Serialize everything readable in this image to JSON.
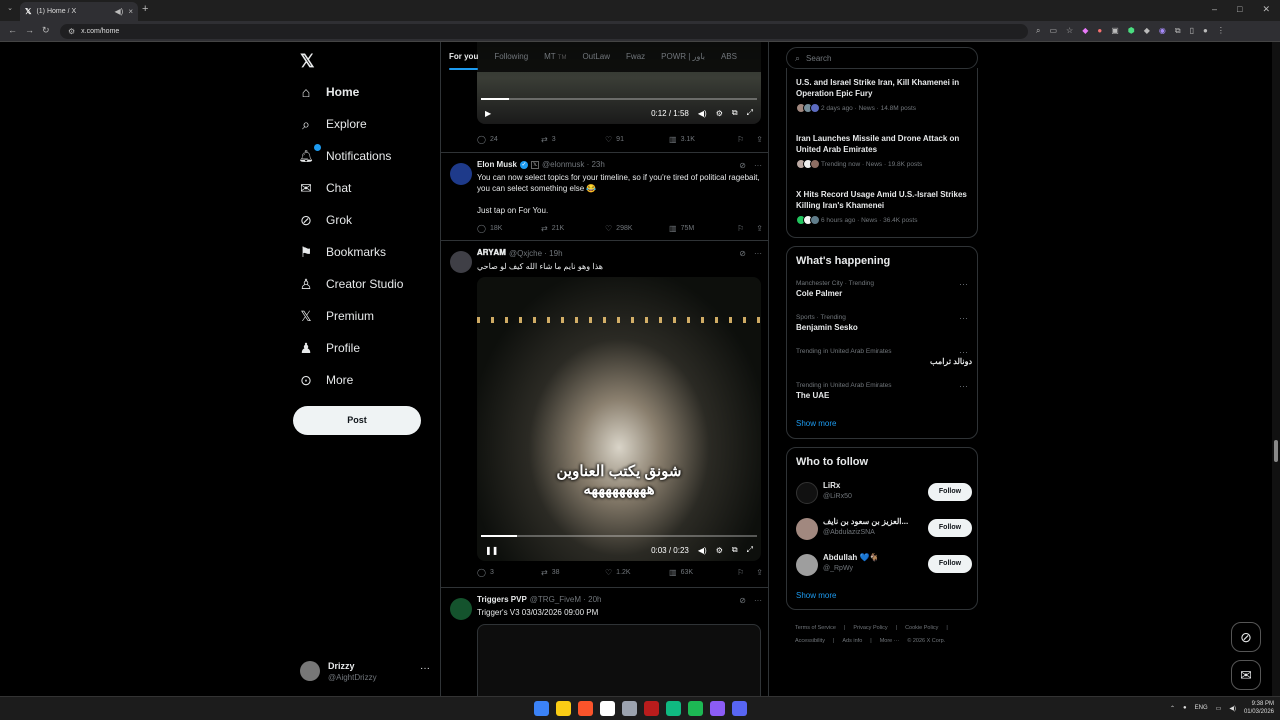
{
  "browser": {
    "tab_title": "(1) Home / X",
    "url": "x.com/home",
    "sound_icon": "speaker-icon",
    "close_glyph": "×",
    "new_tab_glyph": "+",
    "back_glyph": "←",
    "forward_glyph": "→",
    "reload_glyph": "↻",
    "minimize_glyph": "–",
    "maximize_glyph": "□",
    "window_close_glyph": "✕"
  },
  "nav": {
    "logo": "𝕏",
    "items": [
      {
        "label": "Home",
        "icon": "home-icon",
        "glyph": "⌂"
      },
      {
        "label": "Explore",
        "icon": "search-icon",
        "glyph": "⌕"
      },
      {
        "label": "Notifications",
        "icon": "bell-icon",
        "glyph": "🔔︎"
      },
      {
        "label": "Chat",
        "icon": "mail-icon",
        "glyph": "✉"
      },
      {
        "label": "Grok",
        "icon": "grok-icon",
        "glyph": "⊘"
      },
      {
        "label": "Bookmarks",
        "icon": "bookmark-icon",
        "glyph": "⚑"
      },
      {
        "label": "Creator Studio",
        "icon": "creator-icon",
        "glyph": "♙"
      },
      {
        "label": "Premium",
        "icon": "x-premium-icon",
        "glyph": "𝕏"
      },
      {
        "label": "Profile",
        "icon": "person-icon",
        "glyph": "♟"
      },
      {
        "label": "More",
        "icon": "more-circle-icon",
        "glyph": "⊙"
      }
    ],
    "post_label": "Post",
    "account": {
      "name": "Drizzy",
      "handle": "@AightDrizzy",
      "more": "···"
    }
  },
  "feed_tabs": [
    {
      "label": "For you",
      "suffix": ""
    },
    {
      "label": "Following",
      "suffix": ""
    },
    {
      "label": "MT",
      "suffix": "TM"
    },
    {
      "label": "OutLaw",
      "suffix": ""
    },
    {
      "label": "Fwaz",
      "suffix": ""
    },
    {
      "label": "POWR | باور",
      "suffix": ""
    },
    {
      "label": "ABS",
      "suffix": ""
    }
  ],
  "video1": {
    "time": "0:12 / 1:58",
    "progress": 0.1
  },
  "post0_actions": {
    "replies": "24",
    "reposts": "3",
    "likes": "91",
    "views": "3.1K"
  },
  "post1": {
    "name": "Elon Musk",
    "affiliation": "𝕏",
    "handle": "@elonmusk · 23h",
    "text": "You can now select topics for your timeline, so if you're tired of political ragebait, you can select something else 😂\n\nJust tap on For You.",
    "replies": "18K",
    "reposts": "21K",
    "likes": "298K",
    "views": "75M"
  },
  "post2": {
    "name": "𝐀𝐑𝐘𝐀𝐌",
    "handle": "@Qxjche · 19h",
    "text": "هذا وهو نايم ما شاء الله كيف لو صاحي",
    "video_caption": "شونق يكتب العناوين\nهههههههههه",
    "video_time": "0:03 / 0:23",
    "video_progress": 0.13,
    "replies": "3",
    "reposts": "38",
    "likes": "1.2K",
    "views": "63K"
  },
  "post3": {
    "name": "Triggers PVP",
    "handle": "@TRG_FiveM · 20h",
    "text": "Trigger's V3  03/03/2026 09:00 PM"
  },
  "search": {
    "placeholder": "Search"
  },
  "news": [
    {
      "title": "U.S. and Israel Strike Iran, Kill Khamenei in Operation Epic Fury",
      "meta": "2 days ago · News · 14.8M posts"
    },
    {
      "title": "Iran Launches Missile and Drone Attack on United Arab Emirates",
      "meta": "Trending now · News · 19.8K posts"
    },
    {
      "title": "X Hits Record Usage Amid U.S.-Israel Strikes Killing Iran's Khamenei",
      "meta": "6 hours ago · News · 36.4K posts"
    }
  ],
  "happening": {
    "title": "What's happening",
    "trends": [
      {
        "category": "Manchester City · Trending",
        "name": "Cole Palmer"
      },
      {
        "category": "Sports · Trending",
        "name": "Benjamin Sesko"
      },
      {
        "category": "Trending in United Arab Emirates",
        "name": "دونالد ترامب"
      },
      {
        "category": "Trending in United Arab Emirates",
        "name": "The UAE"
      }
    ],
    "show_more": "Show more",
    "more_glyph": "···"
  },
  "who_to_follow": {
    "title": "Who to follow",
    "people": [
      {
        "name": "LiRx",
        "handle": "@LiRx50",
        "button": "Follow"
      },
      {
        "name": "العزيز بن سعود بن نايف...",
        "handle": "@AbdulazizSNA",
        "button": "Follow"
      },
      {
        "name": "Abdullah 💙🐐",
        "handle": "@_RpWy",
        "button": "Follow"
      }
    ],
    "show_more": "Show more"
  },
  "footer": {
    "links": [
      "Terms of Service",
      "|",
      "Privacy Policy",
      "|",
      "Cookie Policy",
      "|",
      "Accessibility",
      "|",
      "Ads info",
      "|",
      "More ···",
      "© 2026 X Corp."
    ]
  },
  "taskbar": {
    "lang": "ENG",
    "time": "9:38 PM",
    "date": "01/03/2026",
    "icon_colors": [
      "#3b82f6",
      "#facc15",
      "#fb542b",
      "#ffffff",
      "#9ca3af",
      "#b91c1c",
      "#10b981",
      "#1db954",
      "#8b5cf6",
      "#5865f2"
    ]
  },
  "colors": {
    "accent": "#1d9bf0",
    "background": "#000000",
    "border": "#2f3336"
  }
}
